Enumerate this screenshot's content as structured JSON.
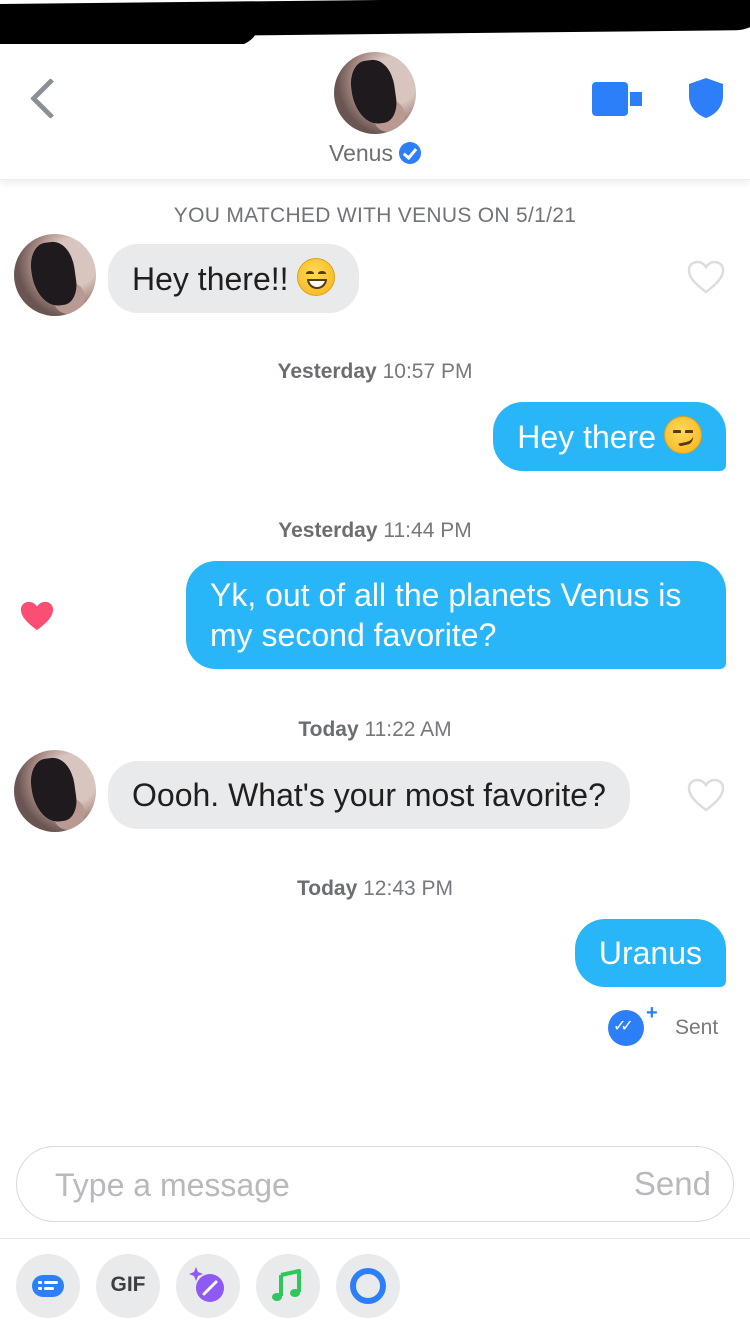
{
  "header": {
    "contact_name": "Venus"
  },
  "match_banner": "YOU MATCHED WITH VENUS ON 5/1/21",
  "messages": [
    {
      "text": "Hey there!!"
    },
    {
      "text": "Hey there"
    },
    {
      "text": "Yk, out of all the planets Venus is my second favorite?"
    },
    {
      "text": "Oooh. What's your most favorite?"
    },
    {
      "text": "Uranus"
    }
  ],
  "timestamps": [
    {
      "day": "Yesterday",
      "time": "10:57 PM"
    },
    {
      "day": "Yesterday",
      "time": "11:44 PM"
    },
    {
      "day": "Today",
      "time": "11:22 AM"
    },
    {
      "day": "Today",
      "time": "12:43 PM"
    }
  ],
  "receipt": {
    "plus": "+",
    "status": "Sent"
  },
  "composer": {
    "placeholder": "Type a message",
    "send_label": "Send"
  },
  "toolbar": {
    "gif_label": "GIF"
  },
  "colors": {
    "outgoing_bubble": "#29b6f9",
    "incoming_bubble": "#e9eaec",
    "accent_blue": "#2d7ff9",
    "like_heart": "#fb4e73",
    "music_green": "#2dc75c",
    "sparkle_purple": "#8e59f4"
  },
  "icons": [
    "back-chevron-icon",
    "video-call-icon",
    "safety-shield-icon",
    "verified-badge-icon",
    "heart-icon",
    "read-receipt-icon",
    "quick-replies-icon",
    "sparkle-icon",
    "music-icon",
    "ring-icon"
  ]
}
